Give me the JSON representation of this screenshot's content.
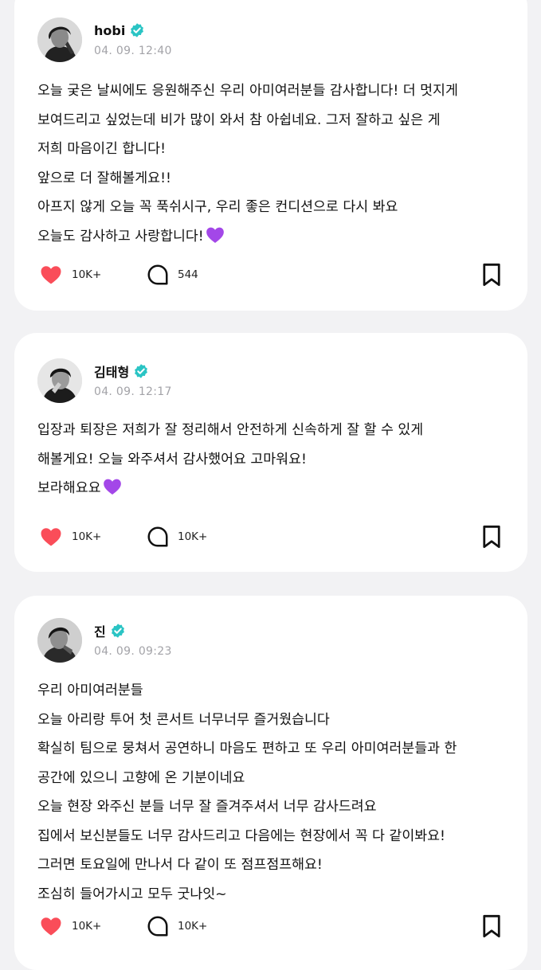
{
  "colors": {
    "background": "#f2f2f4",
    "card": "#ffffff",
    "verified_badge": "#2ac4c4",
    "like_heart": "#fa4d59",
    "purple_heart": "#a347e8",
    "timestamp": "#a3a3a8"
  },
  "posts": [
    {
      "author": "hobi",
      "verified": true,
      "timestamp": "04. 09. 12:40",
      "lines": [
        "오늘 궂은 날씨에도 응원해주신 우리 아미여러분들 감사합니다! 더 멋지게",
        "보여드리고 싶었는데 비가 많이 와서 참 아쉽네요. 그저 잘하고 싶은 게",
        "저희 마음이긴 합니다!",
        "앞으로 더 잘해볼게요!!",
        "아프지 않게 오늘 꼭 푹쉬시구, 우리 좋은 컨디션으로 다시 봐요",
        "오늘도 감사하고 사랑합니다!"
      ],
      "trailing_emoji": "purple-heart",
      "likes": "10K+",
      "comments": "544"
    },
    {
      "author": "김태형",
      "verified": true,
      "timestamp": "04. 09. 12:17",
      "lines": [
        "입장과 퇴장은 저희가 잘 정리해서 안전하게 신속하게 잘 할 수 있게",
        "해볼게요! 오늘 와주셔서 감사했어요 고마워요!",
        "보라해요요"
      ],
      "trailing_emoji": "purple-heart",
      "likes": "10K+",
      "comments": "10K+"
    },
    {
      "author": "진",
      "verified": true,
      "timestamp": "04. 09. 09:23",
      "lines": [
        "우리 아미여러분들",
        "오늘 아리랑 투어 첫 콘서트 너무너무 즐거웠습니다",
        "확실히 팀으로 뭉쳐서 공연하니 마음도 편하고 또 우리 아미여러분들과 한",
        "공간에 있으니 고향에 온 기분이네요",
        "오늘 현장 와주신 분들 너무 잘 즐겨주셔서 너무 감사드려요",
        "집에서 보신분들도 너무 감사드리고 다음에는 현장에서 꼭 다 같이봐요!",
        "그러면 토요일에 만나서 다 같이 또 점프점프해요!",
        "조심히 들어가시고 모두 굿나잇~"
      ],
      "likes": "10K+",
      "comments": "10K+"
    }
  ],
  "icons": {
    "like": "heart-icon",
    "comment": "comment-bubble-icon",
    "bookmark": "bookmark-icon",
    "verified": "verified-badge-icon"
  }
}
